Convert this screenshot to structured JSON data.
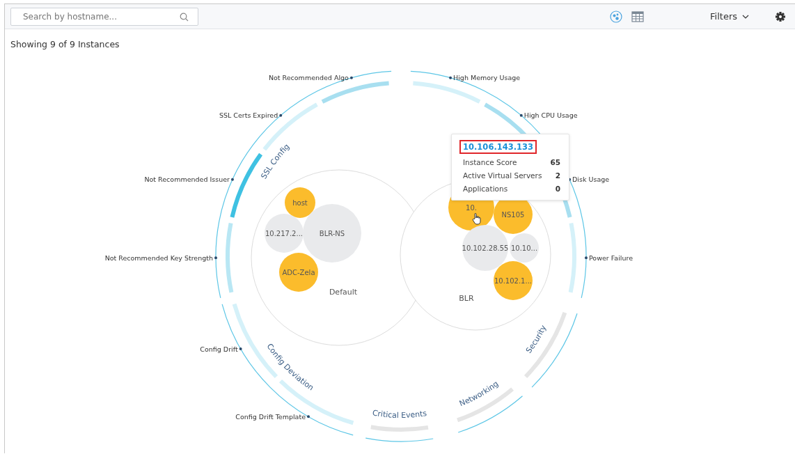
{
  "toolbar": {
    "search": {
      "placeholder": "Search by hostname..."
    },
    "views": [
      {
        "kind": "bubble",
        "selected": true
      },
      {
        "kind": "table",
        "selected": false
      }
    ],
    "filters": "Filters"
  },
  "summary": "Showing 9 of 9 Instances",
  "categories": [
    {
      "label": "SSL Config",
      "issues": [
        {
          "label": "Not Recommended Algo",
          "color": "#a8dff0"
        },
        {
          "label": "SSL Certs Expired",
          "color": "#d5f1f9"
        },
        {
          "label": "Not Recommended Issuer",
          "color": "#3fc1e2"
        },
        {
          "label": "Not Recommended Key Strength",
          "color": "#b9e7f4"
        }
      ]
    },
    {
      "issues": [
        {
          "label": "High Memory Usage",
          "color": "#d5f1f9"
        },
        {
          "label": "High CPU Usage",
          "color": "#a8dff0"
        },
        {
          "label": "Disk Usage",
          "color": "#a8dff0"
        },
        {
          "label": "Power Failure",
          "color": "#d5f1f9"
        }
      ]
    },
    {
      "label": "Security"
    },
    {
      "label": "Config Deviation",
      "issues": [
        {
          "label": "Config Drift",
          "color": "#d5f1f9"
        },
        {
          "label": "Config Drift Template",
          "color": "#d5f1f9"
        }
      ]
    },
    {
      "label": "Networking"
    },
    {
      "label": "Critical Events"
    }
  ],
  "groups": [
    {
      "label": "Default",
      "instances": [
        {
          "label": "host",
          "color": "#fbbc2c"
        },
        {
          "label": "10.217.2...",
          "color": "#e9eaec"
        },
        {
          "label": "BLR-NS",
          "color": "#e9eaec"
        },
        {
          "label": "ADC-Zela",
          "color": "#fbbc2c"
        }
      ]
    },
    {
      "label": "BLR",
      "instances": [
        {
          "label": "10.",
          "color": "#fbbc2c"
        },
        {
          "label": "NS105",
          "color": "#fbbc2c"
        },
        {
          "label": "10.102.28.55",
          "color": "#e9eaec"
        },
        {
          "label": "10.10...",
          "color": "#e9eaec"
        },
        {
          "label": "10.102.1...",
          "color": "#fbbc2c"
        }
      ]
    }
  ],
  "tooltip": {
    "title": "10.106.143.133",
    "rows": [
      {
        "label": "Instance Score",
        "value": "65"
      },
      {
        "label": "Active Virtual Servers",
        "value": "2"
      },
      {
        "label": "Applications",
        "value": "0"
      }
    ]
  }
}
